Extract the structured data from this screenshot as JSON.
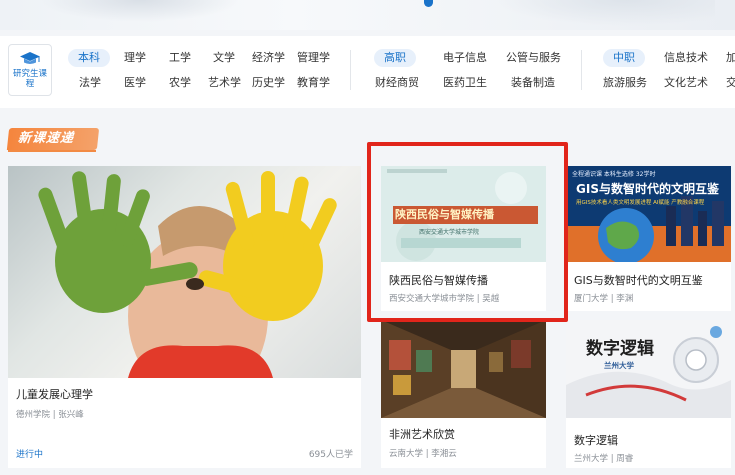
{
  "categories": {
    "graduate": {
      "label": "研究生课程"
    },
    "groups": [
      {
        "pill": "本科",
        "row1": [
          "理学",
          "工学",
          "文学",
          "经济学",
          "管理学"
        ],
        "row2": [
          "法学",
          "医学",
          "农学",
          "艺术学",
          "历史学",
          "教育学"
        ]
      },
      {
        "pill": "高职",
        "row1": [
          "电子信息",
          "公管与服务"
        ],
        "row2": [
          "财经商贸",
          "医药卫生",
          "装备制造"
        ]
      },
      {
        "pill": "中职",
        "row1": [
          "信息技术",
          "加"
        ],
        "row2": [
          "旅游服务",
          "文化艺术",
          "交"
        ]
      }
    ]
  },
  "section": {
    "title": "新课速递"
  },
  "cards": [
    {
      "title": "儿童发展心理学",
      "meta": "德州学院 | 张兴峰",
      "status": "进行中",
      "count": "695人已学"
    },
    {
      "title": "陕西民俗与智媒传播",
      "meta": "西安交通大学城市学院 | 吴越",
      "thumb_text": "陕西民俗与智媒传播",
      "thumb_sub": "西安交通大学城市学院"
    },
    {
      "title": "GIS与数智时代的文明互鉴",
      "meta": "厦门大学 | 李渊",
      "thumb_top": "全程通识课  本科生选修  32学时",
      "thumb_text": "GIS与数智时代的文明互鉴",
      "thumb_sub": "用GIS技术看人类文明发展进程  AI赋能  产教融合课程"
    },
    {
      "title": "非洲艺术欣赏",
      "meta": "云南大学 | 李湘云"
    },
    {
      "title": "数字逻辑",
      "meta": "兰州大学 | 周睿",
      "thumb_text": "数字逻辑",
      "thumb_sub": "兰州大学"
    }
  ],
  "colors": {
    "accent": "#1a73c9",
    "section": "#f5853d",
    "highlight": "#e1251b"
  }
}
